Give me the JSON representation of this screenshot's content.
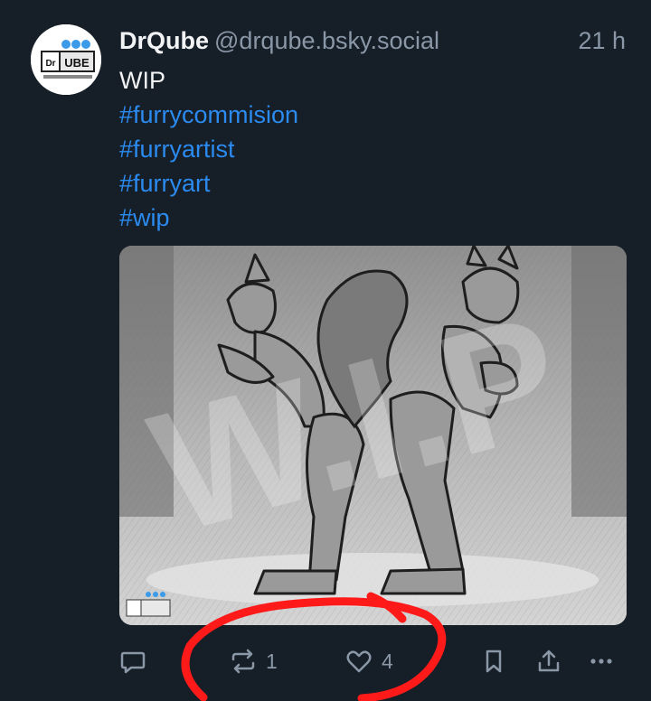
{
  "author": {
    "display_name": "DrQube",
    "handle": "@drqube.bsky.social",
    "avatar_icon": "drqube-logo-icon",
    "avatar_text": "DrQUBE"
  },
  "post": {
    "timestamp": "21 h",
    "text": "WIP",
    "hashtags": [
      "#furrycommision",
      "#furryartist",
      "#furryart",
      "#wip"
    ],
    "image": {
      "watermark_text": "W.I.P",
      "corner_logo_text": "DrQUBE"
    }
  },
  "actions": {
    "reply_icon": "comment-icon",
    "repost_icon": "repost-icon",
    "repost_count": "1",
    "like_icon": "heart-icon",
    "like_count": "4",
    "bookmark_icon": "bookmark-icon",
    "share_icon": "share-icon",
    "more_icon": "more-options-icon"
  },
  "colors": {
    "background": "#161e27",
    "text_primary": "#f1f3f5",
    "text_secondary": "#8a97a6",
    "link": "#2b8bf0",
    "annotation_red": "#ff1a1a"
  }
}
